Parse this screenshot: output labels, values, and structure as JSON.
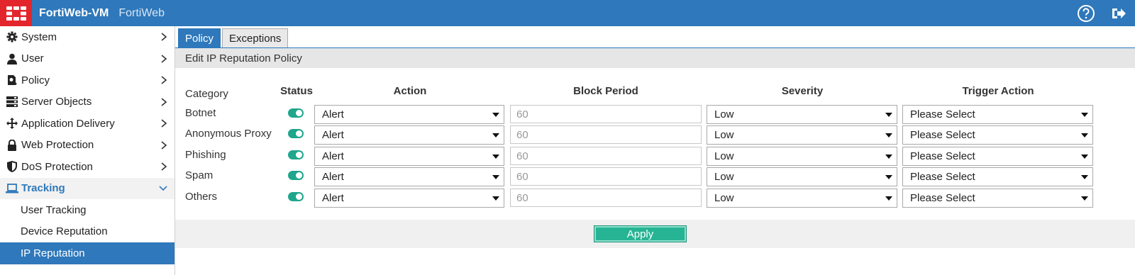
{
  "header": {
    "title": "FortiWeb-VM",
    "subtitle": "FortiWeb",
    "icons": [
      "help-icon",
      "logout-icon"
    ]
  },
  "sidebar": {
    "items": [
      {
        "label": "System",
        "icon": "gear-icon"
      },
      {
        "label": "User",
        "icon": "user-icon"
      },
      {
        "label": "Policy",
        "icon": "policy-icon"
      },
      {
        "label": "Server Objects",
        "icon": "server-icon"
      },
      {
        "label": "Application Delivery",
        "icon": "move-arrows-icon"
      },
      {
        "label": "Web Protection",
        "icon": "lock-icon"
      },
      {
        "label": "DoS Protection",
        "icon": "shield-icon"
      },
      {
        "label": "Tracking",
        "icon": "laptop-icon"
      }
    ],
    "tracking_subitems": [
      {
        "label": "User Tracking"
      },
      {
        "label": "Device Reputation"
      },
      {
        "label": "IP Reputation"
      }
    ]
  },
  "tabs": [
    {
      "label": "Policy"
    },
    {
      "label": "Exceptions"
    }
  ],
  "panel_title": "Edit IP Reputation Policy",
  "table": {
    "headers": {
      "category": "Category",
      "status": "Status",
      "action": "Action",
      "block_period": "Block Period",
      "severity": "Severity",
      "trigger_action": "Trigger Action"
    },
    "rows": [
      {
        "category": "Botnet",
        "status": "on",
        "action": "Alert",
        "block_period": "60",
        "severity": "Low",
        "trigger_action": "Please Select"
      },
      {
        "category": "Anonymous Proxy",
        "status": "on",
        "action": "Alert",
        "block_period": "60",
        "severity": "Low",
        "trigger_action": "Please Select"
      },
      {
        "category": "Phishing",
        "status": "on",
        "action": "Alert",
        "block_period": "60",
        "severity": "Low",
        "trigger_action": "Please Select"
      },
      {
        "category": "Spam",
        "status": "on",
        "action": "Alert",
        "block_period": "60",
        "severity": "Low",
        "trigger_action": "Please Select"
      },
      {
        "category": "Others",
        "status": "on",
        "action": "Alert",
        "block_period": "60",
        "severity": "Low",
        "trigger_action": "Please Select"
      }
    ]
  },
  "apply_label": "Apply",
  "colors": {
    "brand_blue": "#2e78bb",
    "logo_red": "#e3262b",
    "toggle_green": "#1fa68c",
    "apply_green": "#26b494"
  }
}
